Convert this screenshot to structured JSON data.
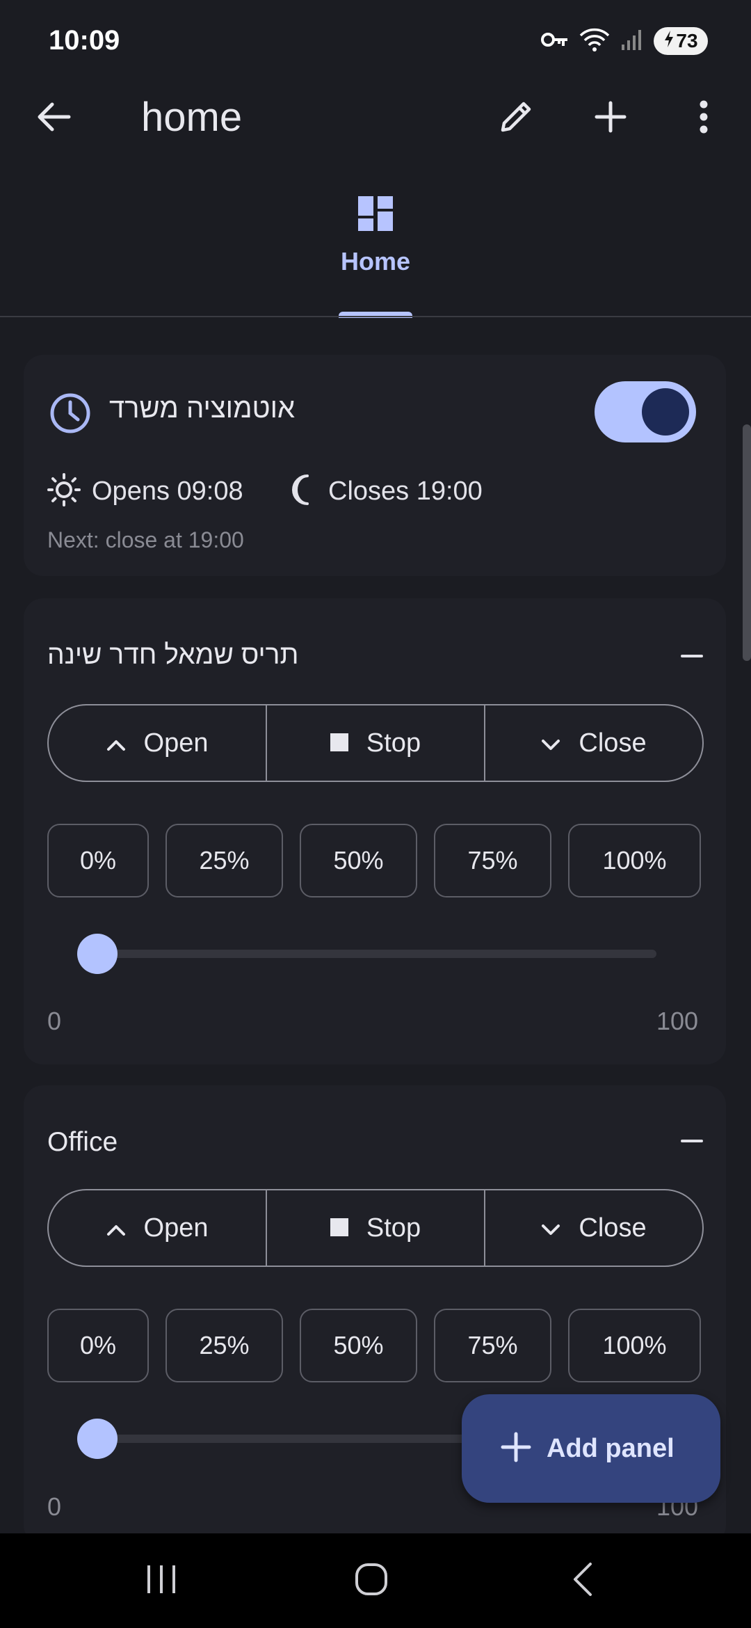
{
  "status_bar": {
    "time": "10:09",
    "battery": "73",
    "icons": [
      "vpn-key-icon",
      "wifi-icon",
      "signal-icon",
      "battery-charging-icon"
    ]
  },
  "app_bar": {
    "title": "home",
    "icons": [
      "back-arrow-icon",
      "edit-pencil-icon",
      "add-icon",
      "more-vert-icon"
    ]
  },
  "tabs": [
    {
      "label": "Home",
      "icon": "dashboard-icon",
      "selected": true
    }
  ],
  "automation_card": {
    "title": "אוטמוציה משרד",
    "enabled": true,
    "opens": "Opens 09:08",
    "closes": "Closes 19:00",
    "next": "Next: close at 19:00"
  },
  "panels": [
    {
      "title": "תריס שמאל חדר שינה",
      "buttons": {
        "open": "Open",
        "stop": "Stop",
        "close": "Close"
      },
      "presets": [
        "0%",
        "25%",
        "50%",
        "75%",
        "100%"
      ],
      "slider": {
        "min": "0",
        "max": "100",
        "value": 0
      }
    },
    {
      "title": "Office",
      "buttons": {
        "open": "Open",
        "stop": "Stop",
        "close": "Close"
      },
      "presets": [
        "0%",
        "25%",
        "50%",
        "75%",
        "100%"
      ],
      "slider": {
        "min": "0",
        "max": "100",
        "value": 0
      }
    }
  ],
  "fab": {
    "label": "Add panel"
  },
  "colors": {
    "background": "#1b1c22",
    "accent": "#b7c4ff",
    "fab": "#34447e"
  }
}
